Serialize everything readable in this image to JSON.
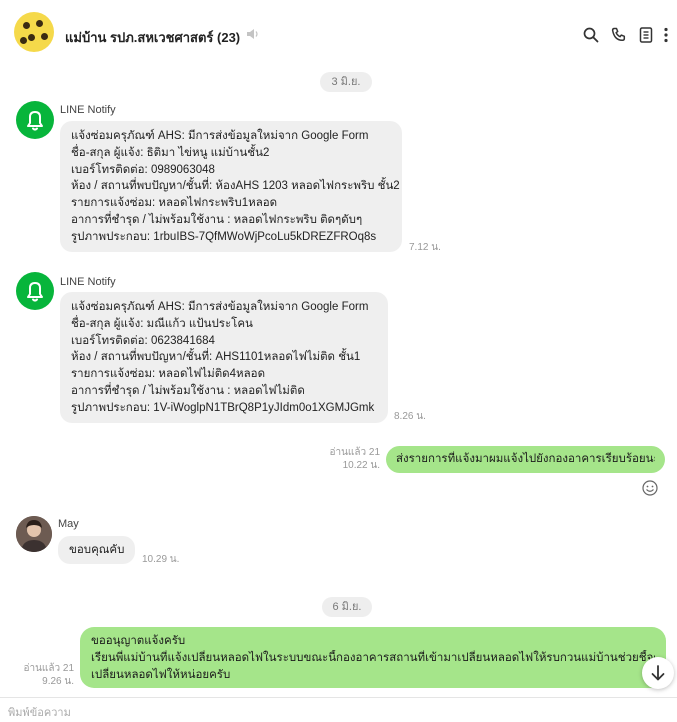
{
  "header": {
    "title": "แม่บ้าน รปภ.สหเวชศาสตร์ (23)",
    "icons": [
      "search-icon",
      "phone-icon",
      "notes-icon",
      "more-icon"
    ]
  },
  "dates": [
    "3 มิ.ย.",
    "6 มิ.ย."
  ],
  "messages": [
    {
      "sender": "LINE Notify",
      "lines": [
        "แจ้งซ่อมครุภัณฑ์ AHS: มีการส่งข้อมูลใหม่จาก Google Form",
        "ชื่อ-สกุล ผู้แจ้ง: ธิติมา ไข่หนู แม่บ้านชั้น2",
        "เบอร์โทรติดต่อ: 0989063048",
        "ห้อง / สถานที่พบปัญหา/ชั้นที่: ห้องAHS 1203 หลอดไฟกระพริบ ชั้น2",
        "รายการแจ้งซ่อม: หลอดไฟกระพริบ1หลอด",
        "อาการที่ชำรุด / ไม่พร้อมใช้งาน : หลอดไฟกระพริบ ติดๆดับๆ",
        "รูปภาพประกอบ: 1rbuIBS-7QfMWoWjPcoLu5kDREZFROq8s"
      ],
      "time": "7.12 น."
    },
    {
      "sender": "LINE Notify",
      "lines": [
        "แจ้งซ่อมครุภัณฑ์ AHS: มีการส่งข้อมูลใหม่จาก Google Form",
        "ชื่อ-สกุล ผู้แจ้ง: มณีแก้ว แป้นประโคน",
        "เบอร์โทรติดต่อ: 0623841684",
        "ห้อง / สถานที่พบปัญหา/ชั้นที่: AHS1101หลอดไฟไม่ติด ชั้น1",
        "รายการแจ้งซ่อม: หลอดไฟไม่ติด4หลอด",
        "อาการที่ชำรุด / ไม่พร้อมใช้งาน : หลอดไฟไม่ติด",
        "รูปภาพประกอบ: 1V-iWoglpN1TBrQ8P1yJIdm0o1XGMJGmk"
      ],
      "time": "8.26 น."
    },
    {
      "sender": "",
      "read": "อ่านแล้ว 21",
      "time": "10.22 น.",
      "text": "ส่งรายการที่แจ้งมาผมแจ้งไปยังกองอาคารเรียบร้อยนะครับ"
    },
    {
      "sender": "May",
      "text": "ขอบคุณคับ",
      "time": "10.29 น."
    },
    {
      "sender": "",
      "read": "อ่านแล้ว 21",
      "time": "9.26 น.",
      "lines": [
        "ขออนุญาตแจ้งครับ",
        "เรียนพี่แม่บ้านที่แจ้งเปลี่ยนหลอดไฟในระบบขณะนี้กองอาคารสถานที่เข้ามาเปลี่ยนหลอดไฟให้รบกวนแม่บ้านช่วยชี้จุดที่ต้องการ",
        "เปลี่ยนหลอดไฟให้หน่อยครับ"
      ]
    }
  ],
  "input": {
    "placeholder": "พิมพ์ข้อความ"
  },
  "colors": {
    "outgoing": "#a5e58a",
    "incoming": "#efefef",
    "line_green": "#07b53b"
  }
}
